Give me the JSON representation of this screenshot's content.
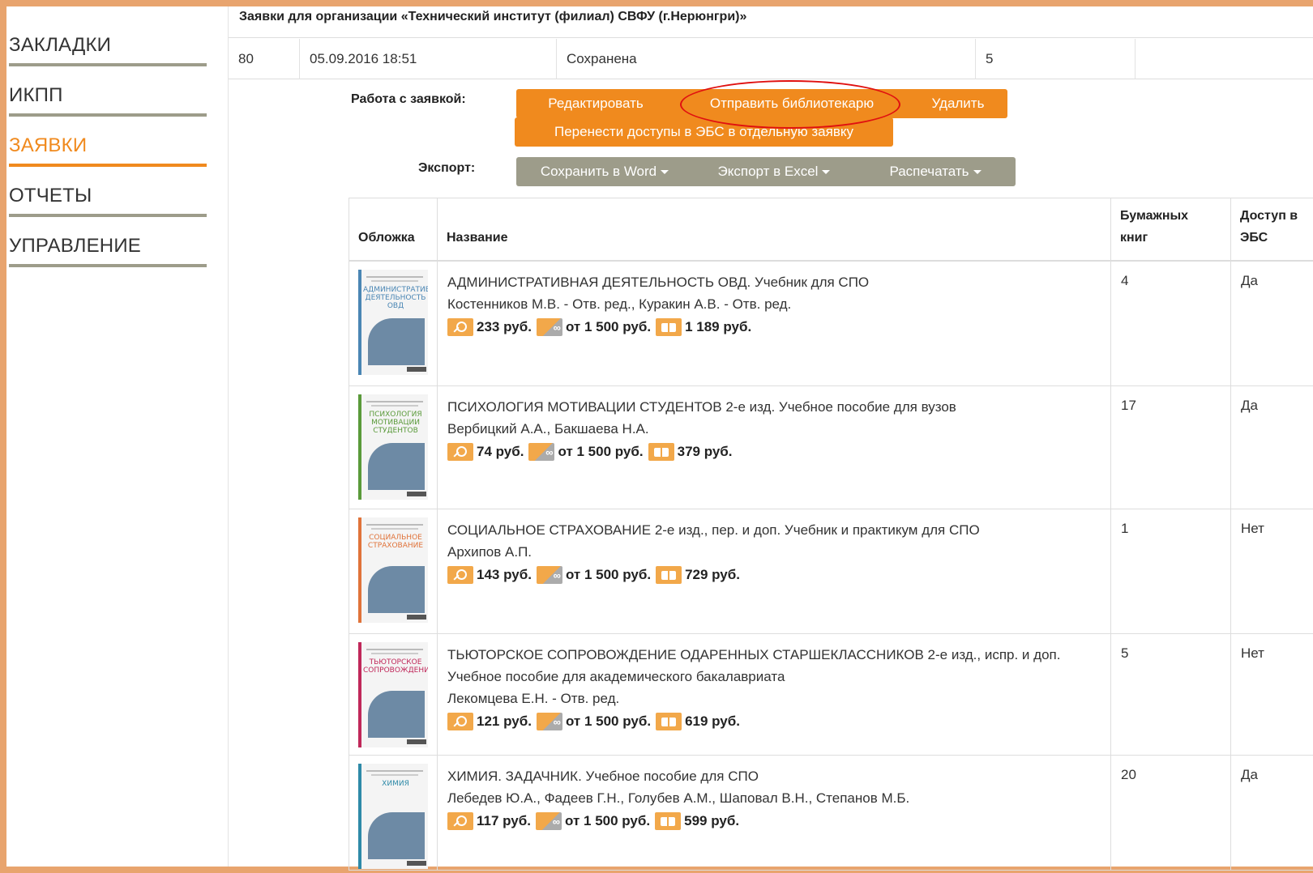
{
  "sidebar": {
    "items": [
      {
        "label": "ЗАКЛАДКИ",
        "active": false
      },
      {
        "label": "ИКПП",
        "active": false
      },
      {
        "label": "ЗАЯВКИ",
        "active": true
      },
      {
        "label": "ОТЧЕТЫ",
        "active": false
      },
      {
        "label": "УПРАВЛЕНИЕ",
        "active": false
      }
    ]
  },
  "header": {
    "title": "Заявки для организации «Технический институт (филиал) СВФУ (г.Нерюнгри)»",
    "order": {
      "id": "80",
      "date": "05.09.2016 18:51",
      "status": "Сохранена",
      "count": "5",
      "extra": ""
    }
  },
  "actions": {
    "work_label": "Работа с заявкой:",
    "edit": "Редактировать",
    "send": "Отправить библиотекарю",
    "delete": "Удалить",
    "move": "Перенести доступы в ЭБС в отдельную заявку",
    "export_label": "Экспорт:",
    "word": "Сохранить в Word",
    "excel": "Экспорт в Excel",
    "print": "Распечатать"
  },
  "table": {
    "headers": {
      "cover": "Обложка",
      "name": "Название",
      "paper": "Бумажных книг",
      "ebs": "Доступ в ЭБС"
    },
    "rows": [
      {
        "title": "АДМИНИСТРАТИВНАЯ ДЕЯТЕЛЬНОСТЬ ОВД. Учебник для СПО",
        "authors": "Костенников М.В. - Отв. ред., Куракин А.В. - Отв. ред.",
        "price_key": "233 руб.",
        "price_inf": "от 1 500 руб.",
        "price_book": "1 189 руб.",
        "paper": "4",
        "ebs": "Да",
        "cover_text": "АДМИНИСТРАТИВНАЯ ДЕЯТЕЛЬНОСТЬ ОВД",
        "cover_color": "#4a86b4"
      },
      {
        "title": "ПСИХОЛОГИЯ МОТИВАЦИИ СТУДЕНТОВ 2-е изд. Учебное пособие для вузов",
        "authors": "Вербицкий А.А., Бакшаева Н.А.",
        "price_key": "74 руб.",
        "price_inf": "от 1 500 руб.",
        "price_book": "379 руб.",
        "paper": "17",
        "ebs": "Да",
        "cover_text": "ПСИХОЛОГИЯ МОТИВАЦИИ СТУДЕНТОВ",
        "cover_color": "#5a9a3a"
      },
      {
        "title": "СОЦИАЛЬНОЕ СТРАХОВАНИЕ 2-е изд., пер. и доп. Учебник и практикум для СПО",
        "authors": "Архипов А.П.",
        "price_key": "143 руб.",
        "price_inf": "от 1 500 руб.",
        "price_book": "729 руб.",
        "paper": "1",
        "ebs": "Нет",
        "cover_text": "СОЦИАЛЬНОЕ СТРАХОВАНИЕ",
        "cover_color": "#e0733a"
      },
      {
        "title": "ТЬЮТОРСКОЕ СОПРОВОЖДЕНИЕ ОДАРЕННЫХ СТАРШЕКЛАССНИКОВ 2-е изд., испр. и доп. Учебное пособие для академического бакалавриата",
        "authors": "Лекомцева Е.Н. - Отв. ред.",
        "price_key": "121 руб.",
        "price_inf": "от 1 500 руб.",
        "price_book": "619 руб.",
        "paper": "5",
        "ebs": "Нет",
        "cover_text": "ТЬЮТОРСКОЕ СОПРОВОЖДЕНИЕ",
        "cover_color": "#c0285a"
      },
      {
        "title": "ХИМИЯ. ЗАДАЧНИК. Учебное пособие для СПО",
        "authors": "Лебедев Ю.А., Фадеев Г.Н., Голубев А.М., Шаповал В.Н., Степанов М.Б.",
        "price_key": "117 руб.",
        "price_inf": "от 1 500 руб.",
        "price_book": "599 руб.",
        "paper": "20",
        "ebs": "Да",
        "cover_text": "ХИМИЯ",
        "cover_color": "#2e8aa8"
      }
    ]
  },
  "colors": {
    "accent": "#f08a1e",
    "grey_button": "#9d9c8a",
    "highlight": "#e01010"
  }
}
